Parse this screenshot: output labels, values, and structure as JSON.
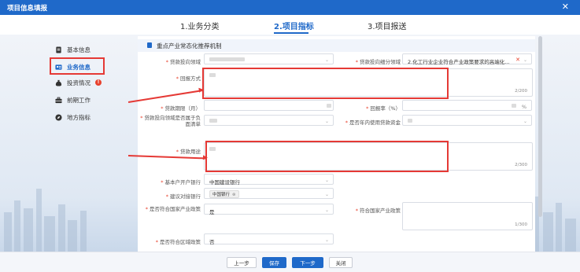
{
  "window": {
    "title": "项目信息填报"
  },
  "steps": [
    {
      "label": "1.业务分类"
    },
    {
      "label": "2.项目指标"
    },
    {
      "label": "3.项目报送"
    }
  ],
  "sidebar": {
    "items": [
      {
        "label": "基本信息",
        "icon": "document-icon"
      },
      {
        "label": "业务信息",
        "icon": "id-card-icon"
      },
      {
        "label": "投资情况",
        "icon": "money-bag-icon",
        "warning": "!"
      },
      {
        "label": "前期工作",
        "icon": "briefcase-icon"
      },
      {
        "label": "地方指标",
        "icon": "compass-icon"
      }
    ]
  },
  "section": {
    "title": "重点产业常态化推荐机制"
  },
  "form": {
    "loan_field_label": "贷款投向领域",
    "loan_subfield_label": "贷款投向细分领域",
    "loan_subfield_value": "2.化工行业企业符合产业政策要求的高端化...",
    "repay_label": "回报方式",
    "repay_count": "2/200",
    "term_label": "贷款期限（月）",
    "return_rate_label": "回报率（%）",
    "return_rate_unit": "%",
    "negative_list_label": "贷款投向领域是否属于负面清单",
    "use_within_year_label": "是否年内使用贷款资金",
    "purpose_label": "贷款用途",
    "purpose_count": "2/300",
    "basic_bank_label": "基本户开户银行",
    "basic_bank_value": "中国建设银行",
    "suggest_bank_label": "建议对接银行",
    "suggest_bank_tag": "中国银行",
    "policy_label": "是否符合国家产业政策",
    "policy_value": "是",
    "policy_text_label": "符合国家产业政策",
    "policy_text_count": "1/300",
    "region_policy_label": "是否符合区域政策",
    "region_policy_value": "否"
  },
  "footer": {
    "prev": "上一步",
    "save": "保存",
    "next": "下一步",
    "close": "关闭"
  },
  "colors": {
    "primary": "#1f69c9",
    "highlight": "#e53935",
    "required": "#e8412d"
  }
}
